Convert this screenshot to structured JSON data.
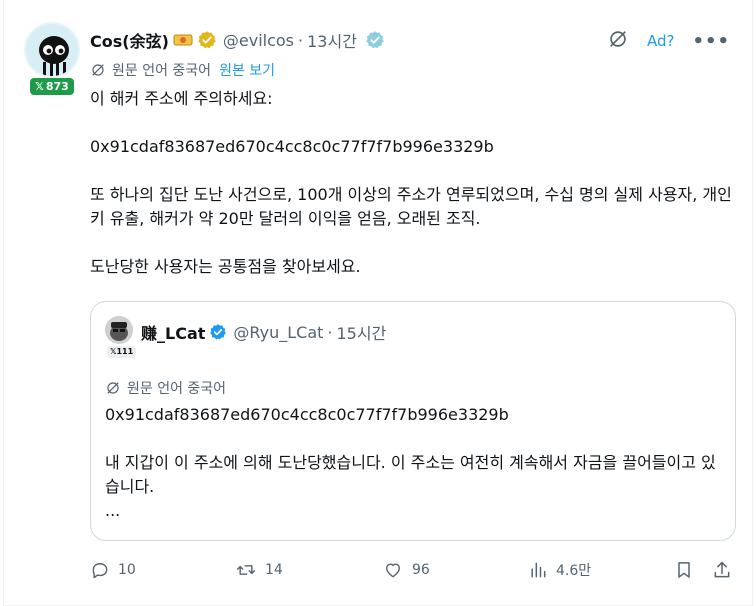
{
  "tweet": {
    "author": {
      "display_name": "Cos(余弦)",
      "handle": "@evilcos",
      "time": "13시간",
      "follower_badge": "873"
    },
    "ad_label": "Ad?",
    "more_label": "•••",
    "translate": {
      "label": "원문 언어 중국어",
      "show_original": "원본 보기"
    },
    "body": {
      "line1": "이 해커 주소에 주의하세요:",
      "address": "0x91cdaf83687ed670c4cc8c0c77f7f7b996e3329b",
      "paragraph": "또 하나의 집단 도난 사건으로, 100개 이상의 주소가 연루되었으며, 수십 명의 실제 사용자, 개인 키 유출, 해커가 약 20만 달러의 이익을 얻음, 오래된 조직.",
      "closing": "도난당한 사용자는 공통점을 찾아보세요."
    },
    "quote": {
      "display_name": "赚_LCat",
      "handle": "@Ryu_LCat",
      "time": "15시간",
      "badge": "111",
      "translate_label": "원문 언어 중국어",
      "address": "0x91cdaf83687ed670c4cc8c0c77f7f7b996e3329b",
      "text": "내 지갑이 이 주소에 의해 도난당했습니다. 이 주소는 여전히 계속해서 자금을 끌어들이고 있습니다.",
      "ellipsis": "..."
    },
    "actions": {
      "replies": "10",
      "retweets": "14",
      "likes": "96",
      "views": "4.6만"
    }
  },
  "colors": {
    "accent": "#1d9bf0",
    "muted": "#536471",
    "text": "#0f1419",
    "border": "#cfd9de",
    "badge_green": "#1d9a4a",
    "verified_gold": "#e2b719"
  },
  "icons": [
    "grok-icon",
    "verified-badge-icon",
    "translate-icon",
    "reply-icon",
    "retweet-icon",
    "like-icon",
    "views-icon",
    "bookmark-icon",
    "share-icon"
  ]
}
